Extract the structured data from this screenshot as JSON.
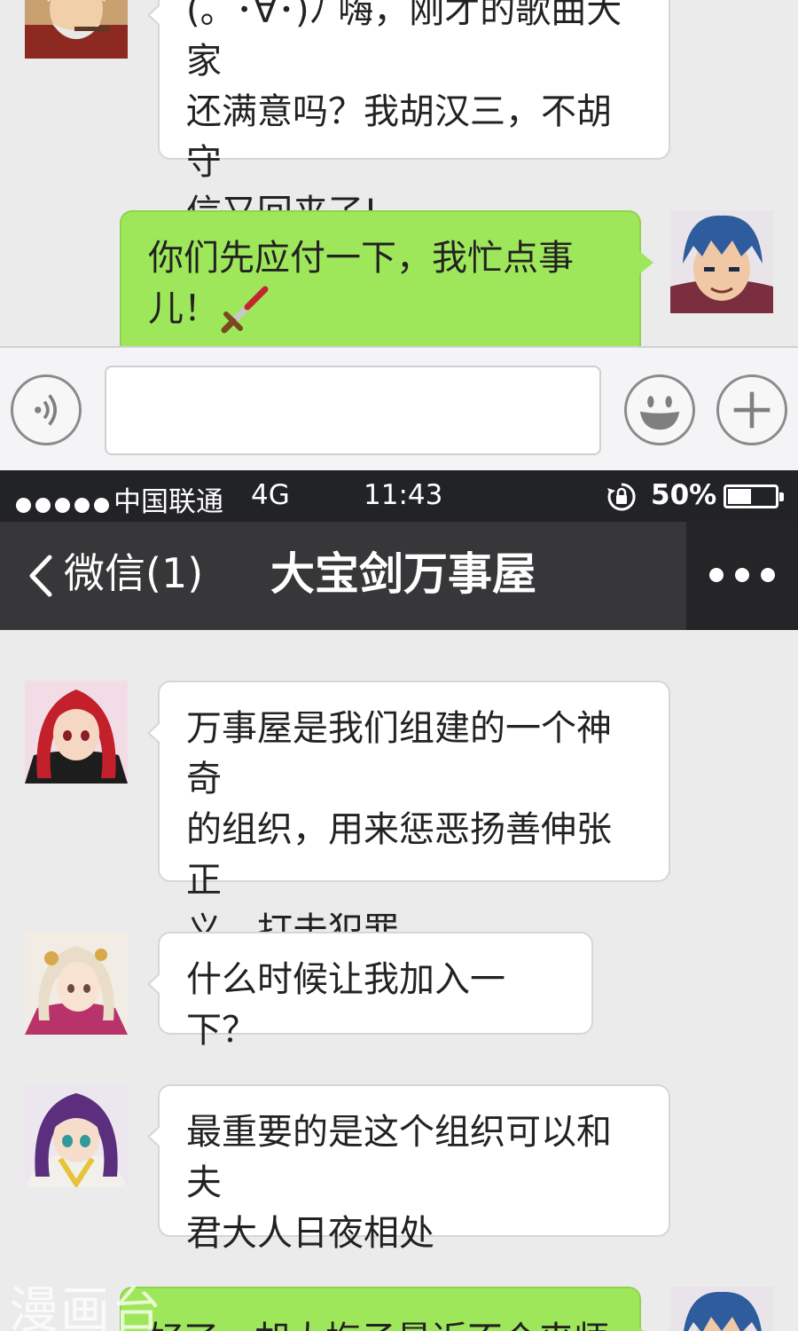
{
  "top_panel": {
    "messages": [
      {
        "side": "incoming",
        "lines": [
          "(。･∀･)ﾉ 嗨，刚才的歌曲大家",
          "还满意吗？我胡汉三，不胡守",
          "信又回来了!"
        ]
      },
      {
        "side": "outgoing",
        "lines": [
          "你们先应付一下，我忙点事",
          "儿！"
        ],
        "emoji": "bloody-dagger"
      }
    ],
    "input_bar": {
      "voice_icon": "voice-wave-icon",
      "emoji_icon": "smiley-icon",
      "add_icon": "plus-icon",
      "input_value": ""
    }
  },
  "status_bar": {
    "signal_dots": 5,
    "carrier": "中国联通",
    "network": "4G",
    "time": "11:43",
    "lock_icon": "rotation-lock-icon",
    "battery": "50%",
    "battery_level": 0.5
  },
  "nav_bar": {
    "back_label": "微信(1)",
    "title": "大宝剑万事屋",
    "more_icon": "more-dots-icon"
  },
  "messages": [
    {
      "side": "incoming",
      "avatar": "red-hair-girl",
      "lines": [
        "万事屋是我们组建的一个神奇",
        "的组织，用来惩恶扬善伸张正",
        "义，打击犯罪..."
      ]
    },
    {
      "side": "incoming",
      "avatar": "white-hair-girl",
      "lines": [
        "什么时候让我加入一下？"
      ]
    },
    {
      "side": "incoming",
      "avatar": "purple-hair-girl",
      "lines": [
        "最重要的是这个组织可以和夫",
        "君大人日夜相处"
      ]
    },
    {
      "side": "outgoing",
      "avatar": "blue-hair-boy",
      "lines": [
        "好了，胡大梅子最近不介来师"
      ]
    }
  ],
  "watermark": "漫画台",
  "colors": {
    "chat_bg": "#ebebeb",
    "incoming_bubble": "#ffffff",
    "outgoing_bubble": "#9fe75a",
    "status_bar": "#222326",
    "nav_bar": "#373739"
  }
}
